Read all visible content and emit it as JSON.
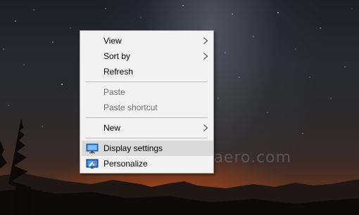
{
  "menu": {
    "items": [
      {
        "label": "View",
        "submenu": true
      },
      {
        "label": "Sort by",
        "submenu": true
      },
      {
        "label": "Refresh"
      },
      {
        "label": "Paste",
        "disabled": true
      },
      {
        "label": "Paste shortcut",
        "disabled": true
      },
      {
        "label": "New",
        "submenu": true
      },
      {
        "label": "Display settings",
        "icon": "display-icon",
        "highlighted": true
      },
      {
        "label": "Personalize",
        "icon": "personalize-icon"
      }
    ]
  },
  "watermark": "http://winaero.com",
  "colors": {
    "menu_bg": "#f2f2f2",
    "menu_border": "#a0a0a0",
    "hover_bg": "#dadada",
    "disabled_text": "#6d6d6d"
  }
}
